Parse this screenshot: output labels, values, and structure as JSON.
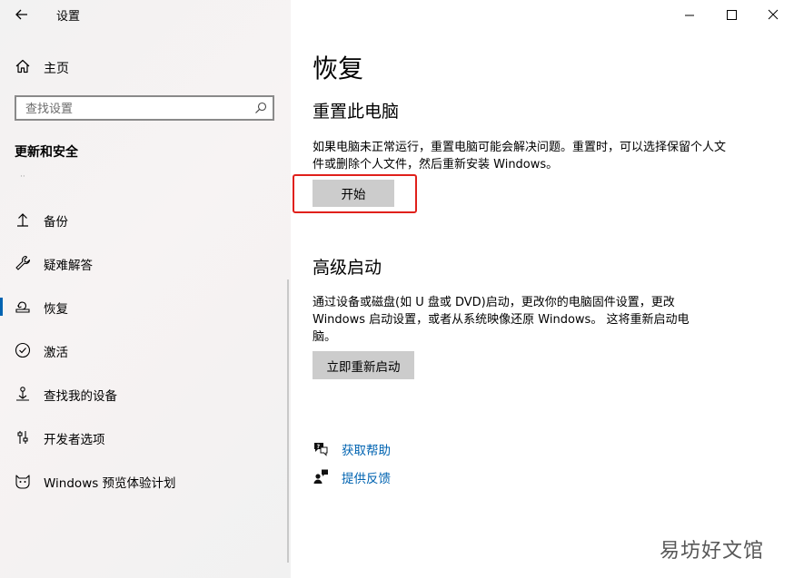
{
  "window": {
    "app_title": "设置"
  },
  "sidebar": {
    "home_label": "主页",
    "search_placeholder": "查找设置",
    "section_heading": "更新和安全",
    "section_dot": "··",
    "items": [
      {
        "label": "备份",
        "icon": "backup-icon"
      },
      {
        "label": "疑难解答",
        "icon": "wrench-icon"
      },
      {
        "label": "恢复",
        "icon": "recovery-icon",
        "selected": true
      },
      {
        "label": "激活",
        "icon": "activation-check-icon"
      },
      {
        "label": "查找我的设备",
        "icon": "find-device-icon"
      },
      {
        "label": "开发者选项",
        "icon": "developer-sliders-icon"
      },
      {
        "label": "Windows 预览体验计划",
        "icon": "insider-cat-icon"
      }
    ]
  },
  "main": {
    "title": "恢复",
    "reset": {
      "heading": "重置此电脑",
      "description": "如果电脑未正常运行，重置电脑可能会解决问题。重置时，可以选择保留个人文件或删除个人文件，然后重新安装 Windows。",
      "button_label": "开始"
    },
    "advanced": {
      "heading": "高级启动",
      "description": "通过设备或磁盘(如 U 盘或 DVD)启动，更改你的电脑固件设置，更改 Windows 启动设置，或者从系统映像还原 Windows。 这将重新启动电脑。",
      "button_label": "立即重新启动"
    },
    "links": [
      {
        "label": "获取帮助",
        "icon": "help-chat-icon"
      },
      {
        "label": "提供反馈",
        "icon": "feedback-person-icon"
      }
    ]
  },
  "watermark": "易坊好文馆",
  "colors": {
    "accent": "#0063b1",
    "highlight": "#e0201b",
    "button_bg": "#cccccc"
  }
}
